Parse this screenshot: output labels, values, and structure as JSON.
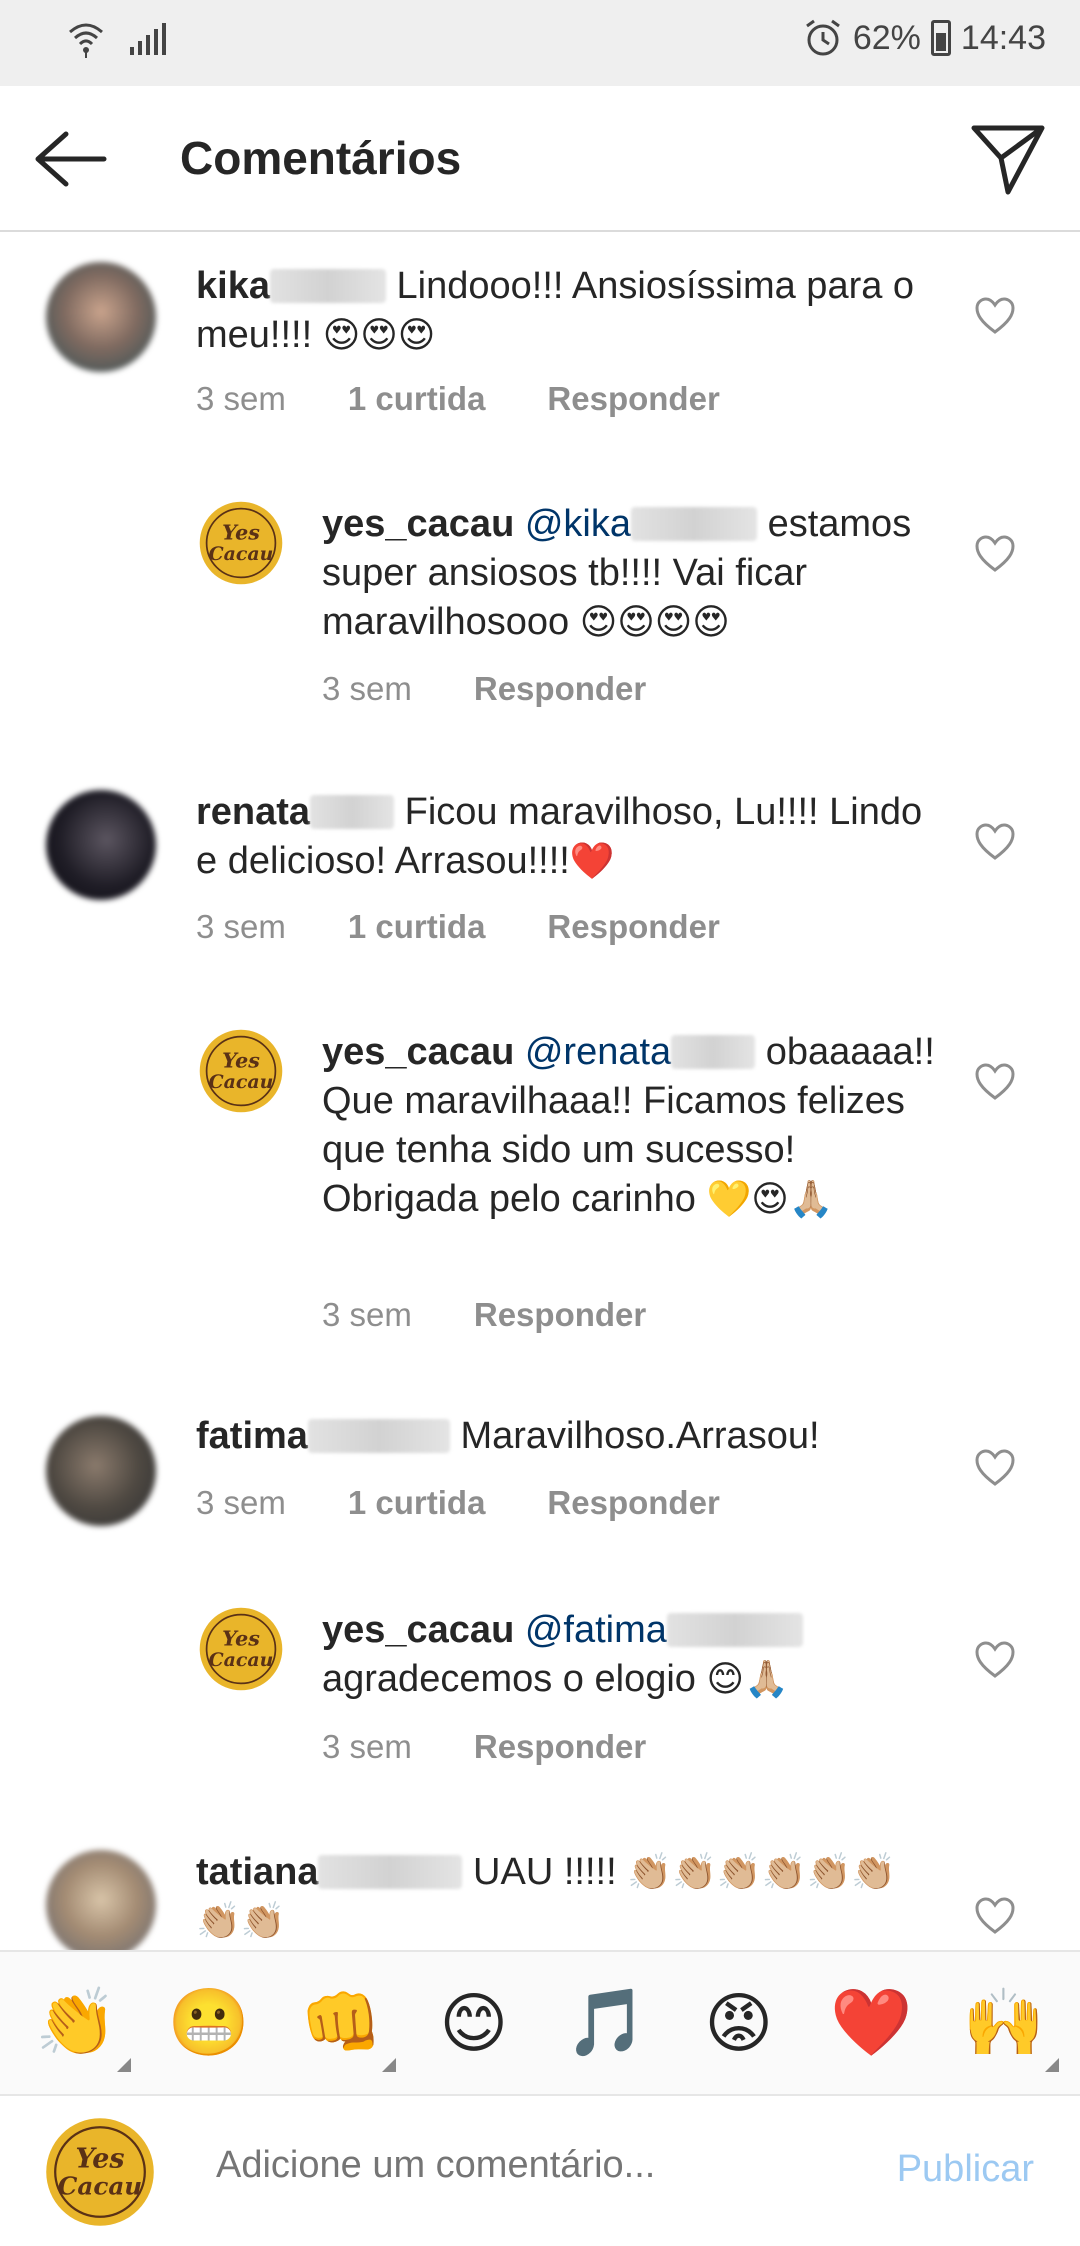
{
  "status_bar": {
    "battery": "62%",
    "time": "14:43"
  },
  "header": {
    "title": "Comentários"
  },
  "comments": [
    {
      "username": "kika",
      "text": "Lindooo!!! Ansiosíssima para o meu!!!!",
      "emojis": "😍😍😍",
      "time": "3 sem",
      "likes": "1 curtida",
      "reply_label": "Responder"
    },
    {
      "username": "yes_cacau",
      "mention": "@kika",
      "text": "estamos super ansiosos tb!!!! Vai ficar maravilhosooo",
      "emojis": "😍😍😍😍",
      "time": "3 sem",
      "reply_label": "Responder"
    },
    {
      "username": "renata",
      "text": "Ficou maravilhoso, Lu!!!! Lindo e delicioso! Arrasou!!!!",
      "emojis": "❤️",
      "time": "3 sem",
      "likes": "1 curtida",
      "reply_label": "Responder"
    },
    {
      "username": "yes_cacau",
      "mention": "@renata",
      "text": "obaaaaa!! Que maravilhaaa!! Ficamos felizes que tenha sido um sucesso! Obrigada pelo carinho",
      "emojis": "💛😍🙏🏼",
      "time": "3 sem",
      "reply_label": "Responder"
    },
    {
      "username": "fatima",
      "text": "Maravilhoso.Arrasou!",
      "time": "3 sem",
      "likes": "1 curtida",
      "reply_label": "Responder"
    },
    {
      "username": "yes_cacau",
      "mention": "@fatima",
      "text": "agradecemos o elogio",
      "emojis": "😊🙏🏼",
      "time": "3 sem",
      "reply_label": "Responder"
    },
    {
      "username": "tatiana",
      "text": "UAU !!!!!",
      "emojis": "👏🏼👏🏼👏🏼👏🏼👏🏼👏🏼 👏🏼👏🏼"
    }
  ],
  "emoji_bar": [
    "👏",
    "😬",
    "👊",
    "😊",
    "🎵",
    "😡",
    "❤️",
    "🙌"
  ],
  "composer": {
    "placeholder": "Adicione um comentário...",
    "publish_label": "Publicar"
  },
  "brand_logo_text": [
    "Yes",
    "Cacau"
  ]
}
